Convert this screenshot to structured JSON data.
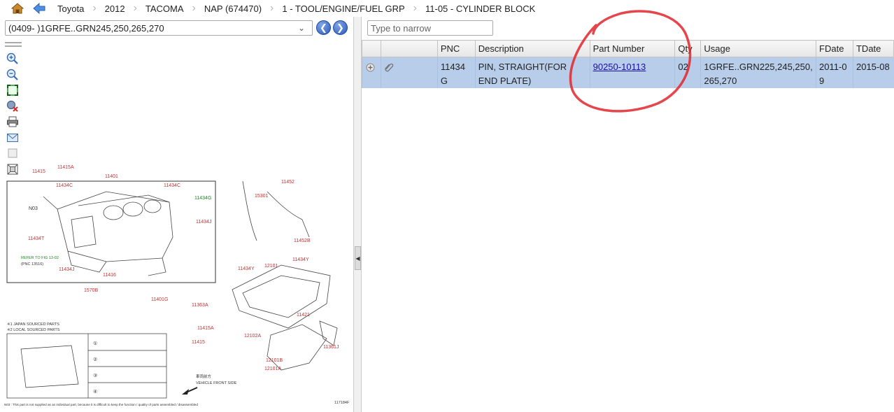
{
  "breadcrumb": {
    "items": [
      "Toyota",
      "2012",
      "TACOMA",
      "NAP (674470)",
      "1 - TOOL/ENGINE/FUEL GRP",
      "11-05 - CYLINDER BLOCK"
    ]
  },
  "left": {
    "model_selected": "(0409- )1GRFE..GRN245,250,265,270",
    "tools": [
      "zoom-in-icon",
      "zoom-out-icon",
      "fit-icon",
      "reset-zoom-icon",
      "print-icon",
      "mail-icon",
      "blank-icon",
      "fullscreen-icon"
    ]
  },
  "diagram": {
    "callouts": [
      "11415A",
      "11415",
      "11401",
      "11434C",
      "11434C",
      "N03",
      "11434G",
      "11434J",
      "11434T",
      "11434J",
      "11416",
      "1570B",
      "11401G",
      "11363A",
      "11415A",
      "11415",
      "15301",
      "11452",
      "11452B",
      "11434Y",
      "12101",
      "11434Y",
      "11421",
      "12102A",
      "12101B",
      "12101A",
      "11361J"
    ],
    "ref_text": "REFER TO FIG 13-02",
    "ref_text2": "(PNC 13516)",
    "legend1": "※1 JAPAN SOURCED PARTS",
    "legend2": "※2 LOCAL SOURCED PARTS",
    "front_label_jp": "車両前方",
    "front_label": "VEHICLE FRONT SIDE",
    "footnote": "N03 : This part is not supplied as an individual part, because it is difficult to keep the function / quality of parts  assembled / disassembled",
    "figure_no": "117184F"
  },
  "right": {
    "filter_placeholder": "Type to narrow",
    "columns": [
      "",
      "",
      "PNC",
      "Description",
      "Part Number",
      "Qty",
      "Usage",
      "FDate",
      "TDate"
    ],
    "rows": [
      {
        "pnc": "11434G",
        "description": "PIN, STRAIGHT(FOR END PLATE)",
        "part_number": "90250-10113",
        "qty": "02",
        "usage": "1GRFE..GRN225,245,250,265,270",
        "fdate": "2011-09",
        "tdate": "2015-08"
      }
    ]
  },
  "colors": {
    "selected_row": "#b8cde9",
    "link": "#1a0dab",
    "annotation": "#e0262c",
    "diagram_red": "#c03030"
  }
}
